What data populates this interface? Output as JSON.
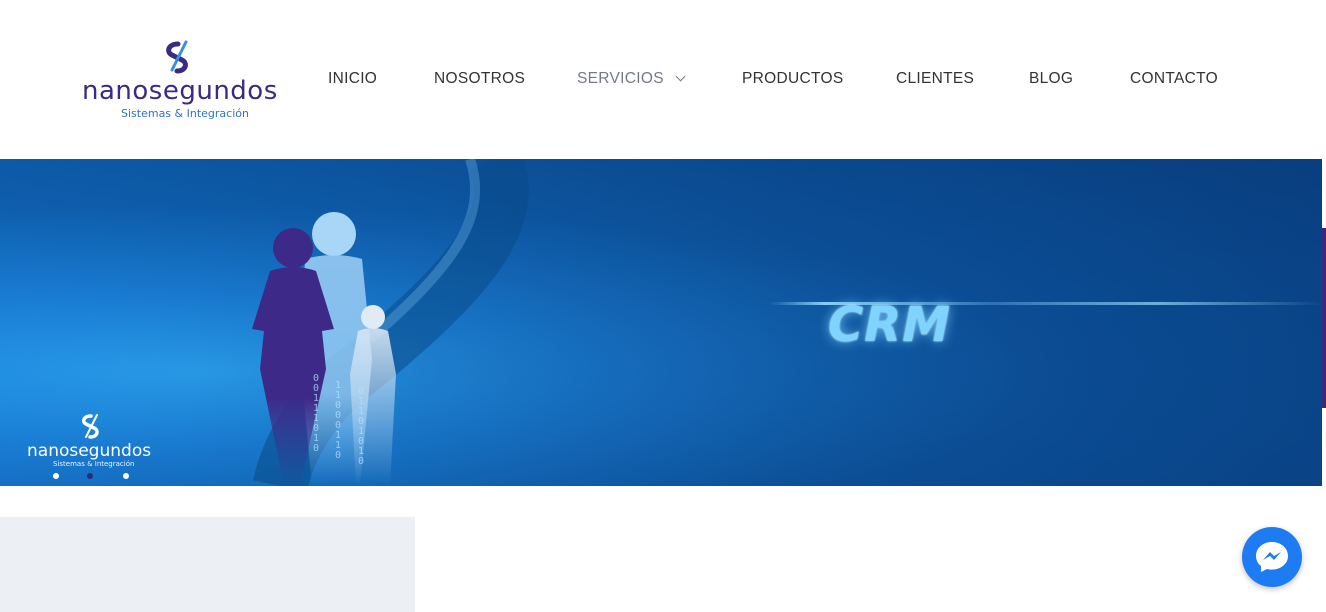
{
  "header": {
    "logo": {
      "name": "nanosegundos",
      "tagline": "Sistemas & Integración"
    },
    "nav": [
      {
        "label": "INICIO"
      },
      {
        "label": "NOSOTROS"
      },
      {
        "label": "SERVICIOS",
        "has_dropdown": true,
        "active": true
      },
      {
        "label": "PRODUCTOS"
      },
      {
        "label": "CLIENTES"
      },
      {
        "label": "BLOG"
      },
      {
        "label": "CONTACTO"
      }
    ]
  },
  "slider": {
    "headline": "CRM",
    "logo": {
      "name": "nanosegundos",
      "tagline": "Sistemas & Integración"
    },
    "dots": [
      {
        "active": false
      },
      {
        "active": true
      },
      {
        "active": false
      }
    ],
    "binary_text": [
      "0 0 1 1 1 0 1 0",
      "1 1 0 0 0 1 1 0",
      "0 1 1 0 1 0 1 0"
    ]
  },
  "chat_widget": {
    "icon": "messenger-icon"
  },
  "colors": {
    "brand_purple": "#3a2a84",
    "brand_blue": "#2e73c8",
    "hero_blue": "#0e5fae",
    "messenger_blue": "#1e7cf2"
  }
}
